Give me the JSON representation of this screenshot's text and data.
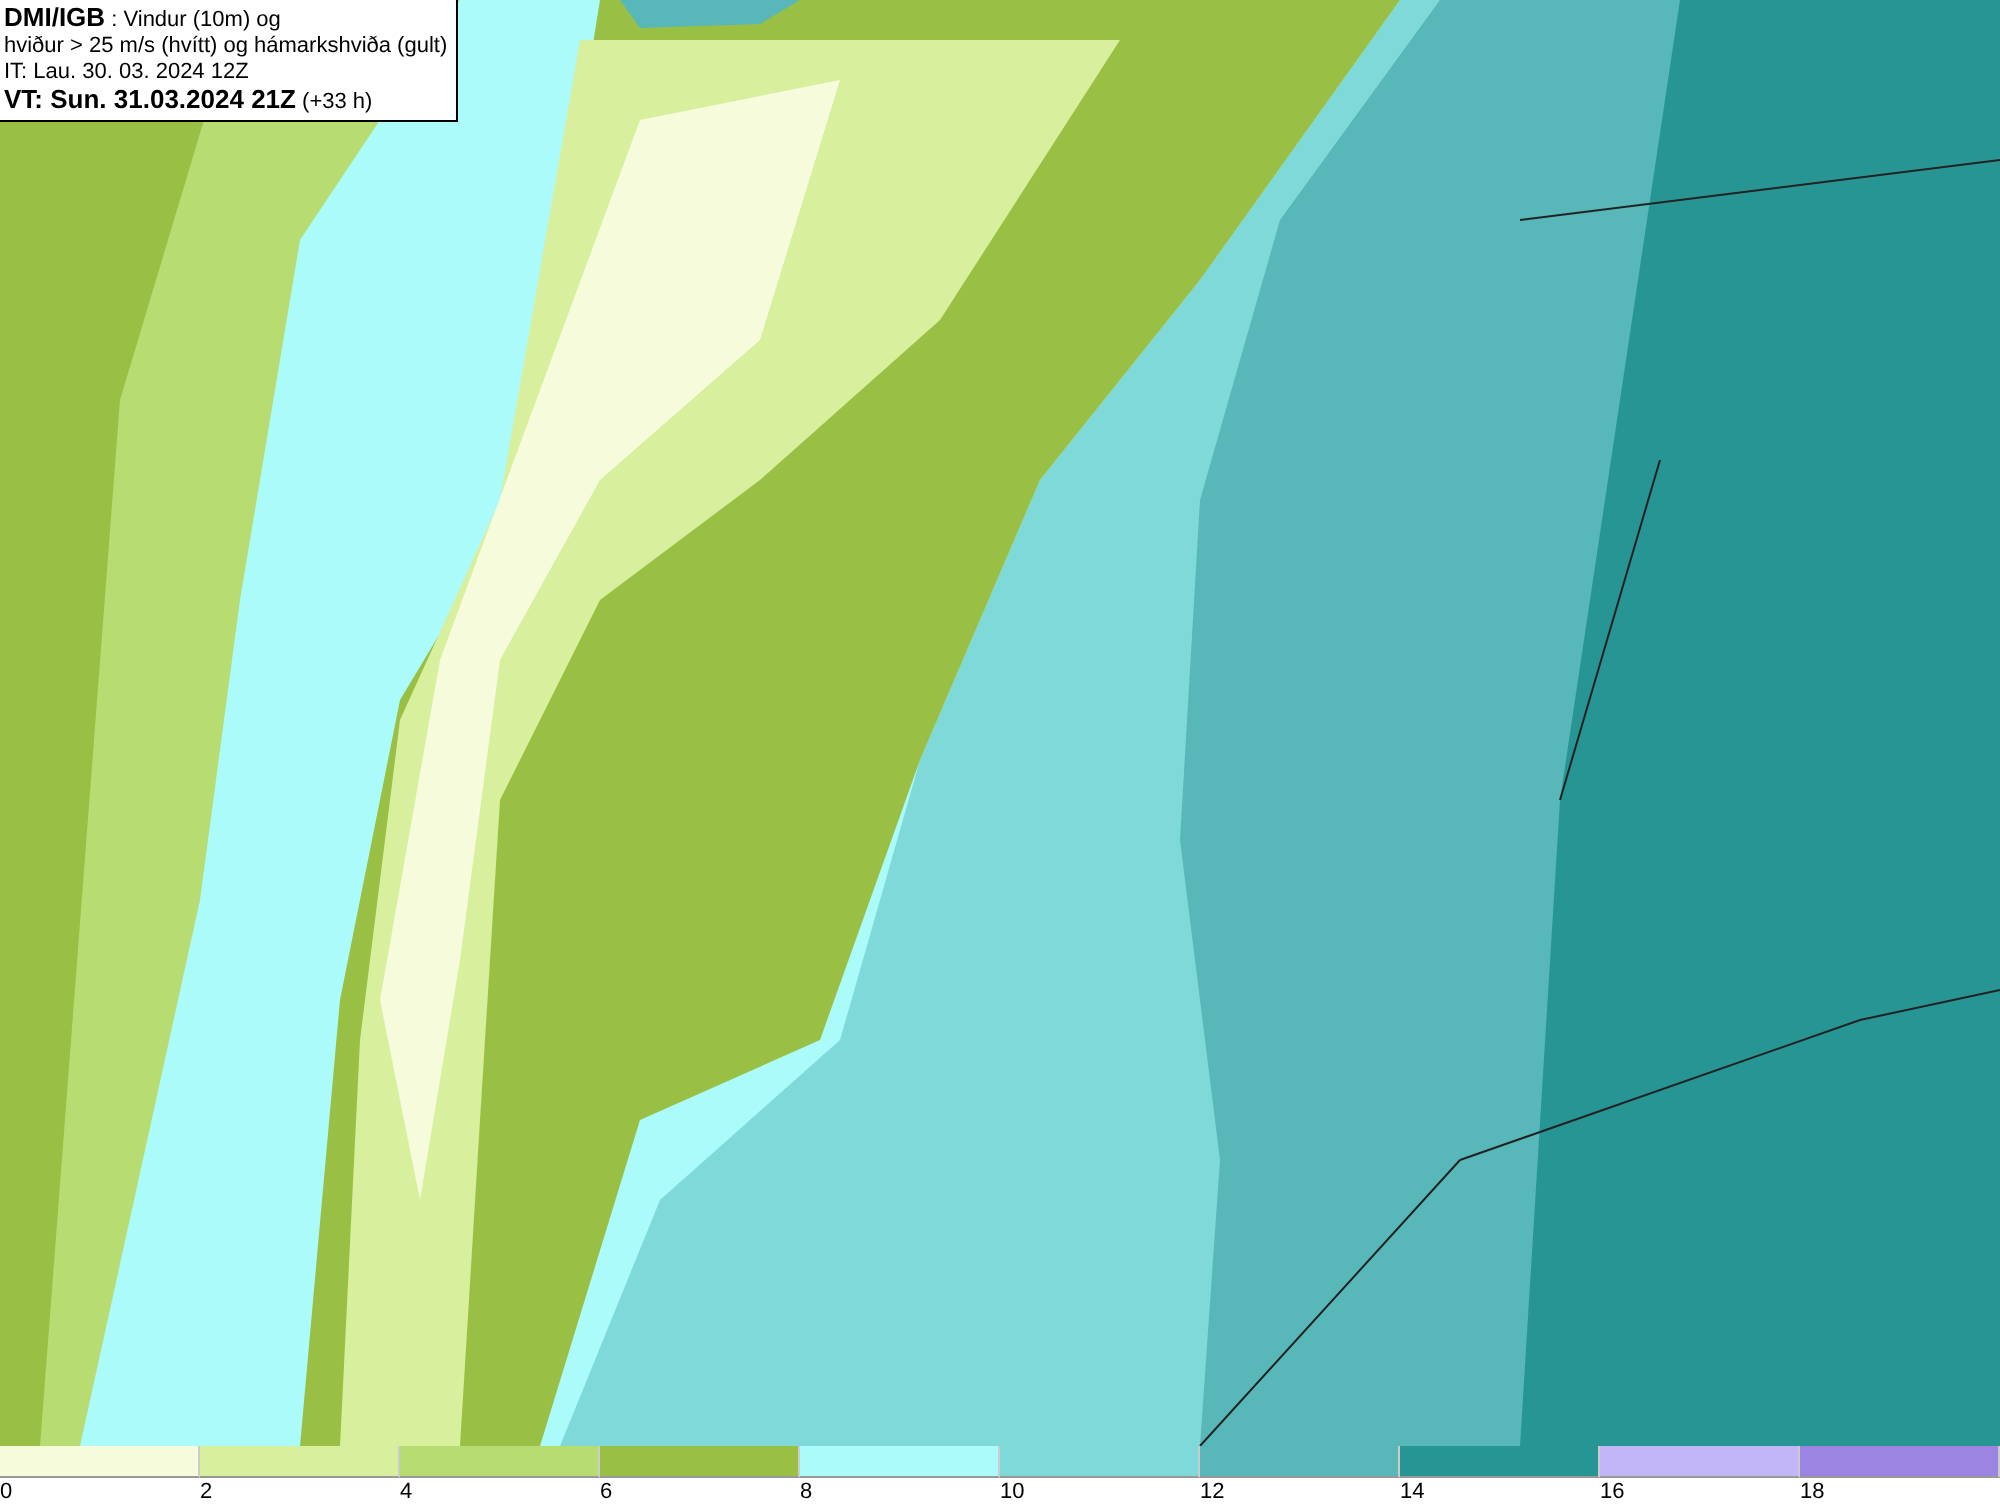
{
  "header": {
    "lines": [
      "**DMI/IGB** : Vindur (10m) og",
      "hviður > 25 m/s (hvítt) og hámarkshviða (gult)",
      "IT: Lau. 30. 03. 2024 12Z",
      "**VT: Sun. 31.03.2024 21Z** (+33 h)"
    ]
  },
  "legend": [
    {
      "label": "0",
      "color": "#f6fbdc"
    },
    {
      "label": "2",
      "color": "#d8ef9e"
    },
    {
      "label": "4",
      "color": "#b7dc72"
    },
    {
      "label": "6",
      "color": "#99bf45"
    },
    {
      "label": "8",
      "color": "#acfbfb"
    },
    {
      "label": "10",
      "color": "#80d9d9"
    },
    {
      "label": "12",
      "color": "#58b7b8"
    },
    {
      "label": "14",
      "color": "#279594"
    },
    {
      "label": "16",
      "color": "#c2b5f8"
    },
    {
      "label": "18",
      "color": "#9b84e2"
    }
  ]
}
